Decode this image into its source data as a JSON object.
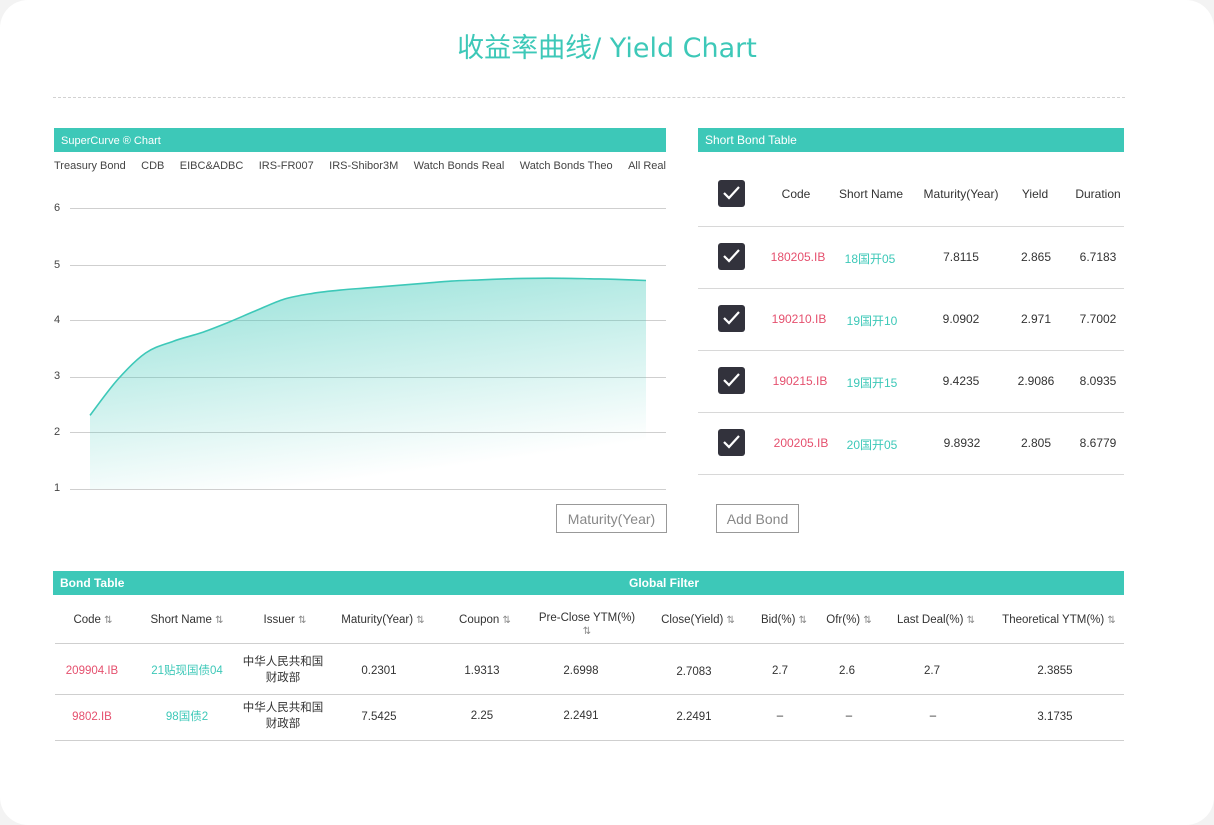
{
  "page_title": "收益率曲线/ Yield Chart",
  "chart_panel": {
    "header": "SuperCurve ® Chart",
    "tabs": [
      "Treasury Bond",
      "CDB",
      "EIBC&ADBC",
      "IRS-FR007",
      "IRS-Shibor3M",
      "Watch Bonds Real",
      "Watch Bonds Theo",
      "All Real"
    ],
    "maturity_button": "Maturity(Year)"
  },
  "chart_data": {
    "type": "area",
    "title": "",
    "xlabel": "Maturity(Year)",
    "ylabel": "",
    "ylim": [
      1,
      6
    ],
    "yticks": [
      "6",
      "5",
      "4",
      "3",
      "2",
      "1"
    ],
    "series": [
      {
        "x": [
          0.0,
          0.05,
          0.1,
          0.15,
          0.2,
          0.25,
          0.3,
          0.35,
          0.4,
          0.45,
          0.5,
          0.55,
          0.6,
          0.65,
          0.7,
          0.75,
          0.8,
          0.85,
          0.9,
          0.95,
          1.0
        ],
        "values": [
          2.31,
          2.95,
          3.42,
          3.63,
          3.78,
          3.97,
          4.18,
          4.38,
          4.48,
          4.54,
          4.58,
          4.62,
          4.66,
          4.7,
          4.72,
          4.74,
          4.75,
          4.75,
          4.74,
          4.73,
          4.71
        ]
      }
    ],
    "grid": true,
    "colors": {
      "line": "#3dc8b8",
      "fill": "#3dc8b8"
    }
  },
  "short_bond_table": {
    "header": "Short Bond Table",
    "columns": [
      "Code",
      "Short Name",
      "Maturity(Year)",
      "Yield",
      "Duration"
    ],
    "rows": [
      {
        "code": "180205.IB",
        "short_name": "18国开05",
        "maturity": "7.8115",
        "yield": "2.865",
        "duration": "6.7183",
        "checked": true
      },
      {
        "code": "190210.IB",
        "short_name": "19国开10",
        "maturity": "9.0902",
        "yield": "2.971",
        "duration": "7.7002",
        "checked": true
      },
      {
        "code": "190215.IB",
        "short_name": "19国开15",
        "maturity": "9.4235",
        "yield": "2.9086",
        "duration": "8.0935",
        "checked": true
      },
      {
        "code": "200205.IB",
        "short_name": "20国开05",
        "maturity": "9.8932",
        "yield": "2.805",
        "duration": "8.6779",
        "checked": true
      }
    ],
    "add_button": "Add Bond"
  },
  "bond_table": {
    "header": "Bond Table",
    "filter_label": "Global Filter",
    "columns": [
      "Code",
      "Short Name",
      "Issuer",
      "Maturity(Year)",
      "Coupon",
      "Pre-Close YTM(%)",
      "Close(Yield)",
      "Bid(%)",
      "Ofr(%)",
      "Last Deal(%)",
      "Theoretical YTM(%)"
    ],
    "sort_icon": "⇅",
    "rows": [
      {
        "code": "209904.IB",
        "short_name": "21贴现国债04",
        "issuer_line1": "中华人民共和国",
        "issuer_line2": "财政部",
        "maturity": "0.2301",
        "coupon": "1.9313",
        "pre_close": "2.6998",
        "close": "2.7083",
        "bid": "2.7",
        "ofr": "2.6",
        "last_deal": "2.7",
        "theo": "2.3855"
      },
      {
        "code": "9802.IB",
        "short_name": "98国债2",
        "issuer_line1": "中华人民共和国",
        "issuer_line2": "财政部",
        "maturity": "7.5425",
        "coupon": "2.25",
        "pre_close": "2.2491",
        "close": "2.2491",
        "bid": "–",
        "ofr": "–",
        "last_deal": "–",
        "theo": "3.1735"
      }
    ]
  },
  "colors": {
    "accent": "#3dc8b8",
    "code_red": "#e5506e",
    "checkbox": "#32323c"
  }
}
